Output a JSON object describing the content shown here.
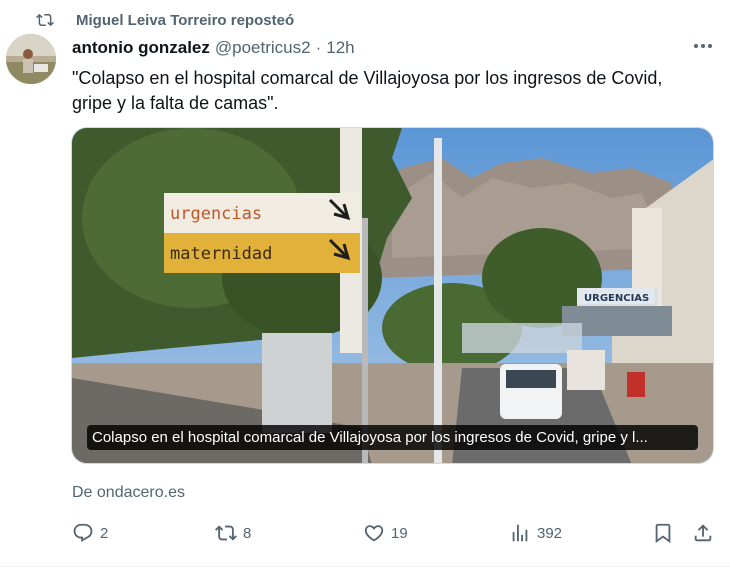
{
  "repost": {
    "icon": "repost-icon",
    "text": "Miguel Leiva Torreiro reposteó"
  },
  "tweet": {
    "author_name": "antonio gonzalez",
    "handle": "@poetricus2",
    "separator": "·",
    "time": "12h",
    "text": "\"Colapso en el hospital comarcal de Villajoyosa por los ingresos de Covid, gripe y la falta de camas\"."
  },
  "media": {
    "caption": "Colapso en el hospital comarcal de Villajoyosa por los ingresos de Covid, gripe y l...",
    "sign_top": "urgencias",
    "sign_bottom": "maternidad",
    "building_sign": "URGENCIAS"
  },
  "source": "De ondacero.es",
  "actions": {
    "replies": "2",
    "reposts": "8",
    "likes": "19",
    "views": "392"
  },
  "colors": {
    "secondary_text": "#536471",
    "primary_text": "#0f1419",
    "border": "#cfd9de"
  }
}
